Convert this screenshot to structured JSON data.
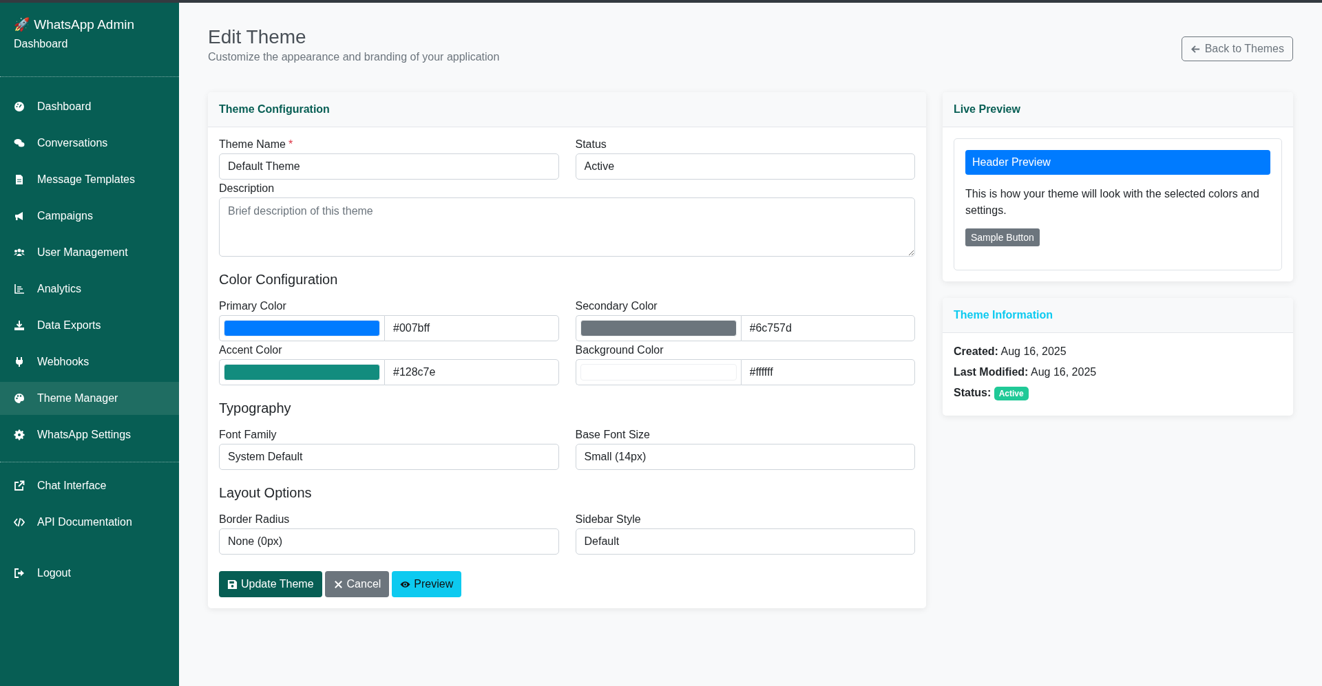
{
  "sidebar": {
    "brand": "🚀 WhatsApp Admin",
    "subtitle": "Dashboard",
    "groups": [
      {
        "divider": true,
        "items": [
          {
            "label": "Dashboard",
            "selected": false
          },
          {
            "label": "Conversations",
            "selected": false
          },
          {
            "label": "Message Templates",
            "selected": false
          },
          {
            "label": "Campaigns",
            "selected": false
          },
          {
            "label": "User Management",
            "selected": false
          },
          {
            "label": "Analytics",
            "selected": false
          },
          {
            "label": "Data Exports",
            "selected": false
          },
          {
            "label": "Webhooks",
            "selected": false
          },
          {
            "label": "Theme Manager",
            "selected": true
          },
          {
            "label": "WhatsApp Settings",
            "selected": false
          }
        ]
      },
      {
        "divider": true,
        "items": [
          {
            "label": "Chat Interface",
            "selected": false
          },
          {
            "label": "API Documentation",
            "selected": false
          }
        ]
      },
      {
        "divider": false,
        "items": [
          {
            "label": "Logout",
            "selected": false
          }
        ]
      }
    ]
  },
  "header": {
    "title": "Edit Theme",
    "subtitle": "Customize the appearance and branding of your application",
    "back_button": "Back to Themes"
  },
  "form": {
    "title": "Theme Configuration",
    "sections": [
      {
        "fields": [
          {
            "kind": "text",
            "label": "Theme Name",
            "required_mark": "*",
            "value": "Default Theme"
          },
          {
            "kind": "text",
            "label": "Status",
            "value": "Active"
          },
          {
            "kind": "textarea",
            "label": "Description",
            "placeholder": "Brief description of this theme"
          }
        ]
      },
      {
        "heading": "Color Configuration",
        "fields": [
          {
            "kind": "color",
            "label": "Primary Color",
            "color": "#007bff",
            "value": "#007bff"
          },
          {
            "kind": "color",
            "label": "Secondary Color",
            "color": "#6c757d",
            "value": "#6c757d"
          },
          {
            "kind": "color",
            "label": "Accent Color",
            "color": "#128c7e",
            "value": "#128c7e"
          },
          {
            "kind": "color",
            "label": "Background Color",
            "color": "#ffffff",
            "value": "#ffffff"
          }
        ]
      },
      {
        "heading": "Typography",
        "fields": [
          {
            "kind": "text",
            "label": "Font Family",
            "value": "System Default"
          },
          {
            "kind": "text",
            "label": "Base Font Size",
            "value": "Small (14px)"
          }
        ]
      },
      {
        "heading": "Layout Options",
        "fields": [
          {
            "kind": "text",
            "label": "Border Radius",
            "value": "None (0px)"
          },
          {
            "kind": "text",
            "label": "Sidebar Style",
            "value": "Default"
          }
        ]
      }
    ],
    "buttons": [
      {
        "kind": "save",
        "label": "Update Theme"
      },
      {
        "kind": "cancel",
        "label": "Cancel"
      },
      {
        "kind": "preview",
        "label": "Preview"
      }
    ]
  },
  "live_preview": {
    "title": "Live Preview",
    "header": "Header Preview",
    "text": "This is how your theme will look with the selected colors and settings.",
    "button": "Sample Button"
  },
  "theme_information": {
    "title": "Theme Information",
    "rows": [
      {
        "kind": "text",
        "label": "Created:",
        "value": "Aug 16, 2025"
      },
      {
        "kind": "text",
        "label": "Last Modified:",
        "value": "Aug 16, 2025"
      },
      {
        "kind": "badge",
        "label": "Status:",
        "value": "Active"
      }
    ]
  }
}
